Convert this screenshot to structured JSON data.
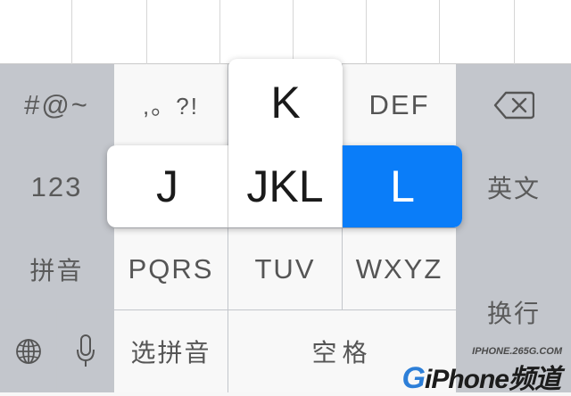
{
  "keyboard": {
    "row1": {
      "symbols_key": "#@~",
      "punct_key": ",。?!",
      "jkl_key": "K",
      "def_key": "DEF",
      "delete_key_icon": "backspace-icon"
    },
    "row2": {
      "numbers_key": "123",
      "english_key": "英文"
    },
    "row3": {
      "pinyin_key": "拼音",
      "pqrs_key": "PQRS",
      "tuv_key": "TUV",
      "wxyz_key": "WXYZ"
    },
    "row4": {
      "globe_icon": "globe-icon",
      "mic_icon": "microphone-icon",
      "choose_pinyin_key": "选拼音",
      "space_key": "空格",
      "return_key": "换行"
    }
  },
  "popup": {
    "left": "J",
    "center": "JKL",
    "right": "L",
    "top": "K"
  },
  "colors": {
    "accent": "#0a7df9",
    "dark_key": "#c3c6cc",
    "light_key": "#f8f8f8"
  },
  "watermark": {
    "domain": "IPHONE.265G.COM",
    "logo_g": "G",
    "logo_text": "iPhone频道"
  }
}
